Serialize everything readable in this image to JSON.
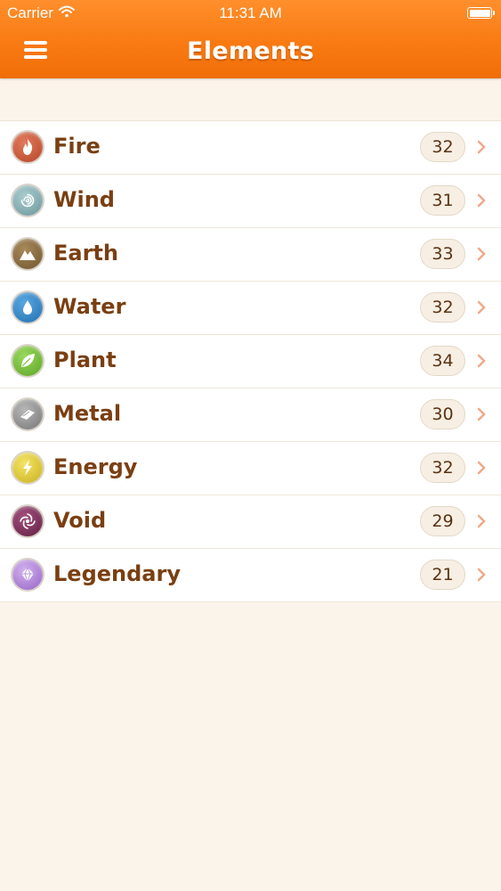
{
  "status_bar": {
    "carrier": "Carrier",
    "time": "11:31 AM"
  },
  "header": {
    "title": "Elements"
  },
  "colors": {
    "accent": "#f7790f",
    "label_text": "#7a3f12",
    "background": "#fbf4ea"
  },
  "elements": [
    {
      "label": "Fire",
      "count": "32",
      "icon": "fire-icon",
      "color": "#c8553a"
    },
    {
      "label": "Wind",
      "count": "31",
      "icon": "wind-icon",
      "color": "#7fa9ad"
    },
    {
      "label": "Earth",
      "count": "33",
      "icon": "mountain-icon",
      "color": "#8a6a3c"
    },
    {
      "label": "Water",
      "count": "32",
      "icon": "water-drop-icon",
      "color": "#2f86c9"
    },
    {
      "label": "Plant",
      "count": "34",
      "icon": "leaf-icon",
      "color": "#77c23a"
    },
    {
      "label": "Metal",
      "count": "30",
      "icon": "metal-icon",
      "color": "#8f8f8f"
    },
    {
      "label": "Energy",
      "count": "32",
      "icon": "lightning-icon",
      "color": "#e5cf2d"
    },
    {
      "label": "Void",
      "count": "29",
      "icon": "vortex-icon",
      "color": "#7b2f59"
    },
    {
      "label": "Legendary",
      "count": "21",
      "icon": "gem-icon",
      "color": "#b487d8"
    }
  ]
}
